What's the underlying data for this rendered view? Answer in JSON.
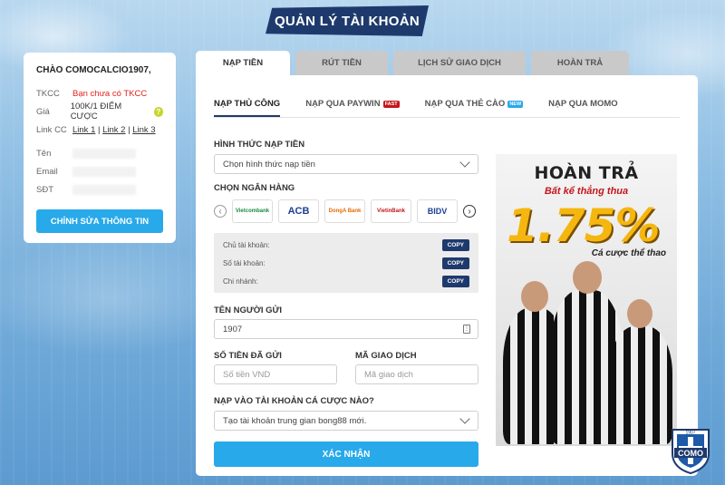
{
  "page_title": "QUẢN LÝ TÀI KHOẢN",
  "account": {
    "greeting": "CHÀO COMOCALCIO1907,",
    "rows": [
      {
        "label": "TKCC",
        "value": "Bạn chưa có TKCC"
      },
      {
        "label": "Giá",
        "value": "100K/1 ĐIỂM CƯỢC"
      },
      {
        "label": "Link CC",
        "links": [
          "Link 1",
          "Link 2",
          "Link 3"
        ]
      }
    ],
    "personal": [
      {
        "label": "Tên"
      },
      {
        "label": "Email"
      },
      {
        "label": "SĐT"
      }
    ],
    "edit_button": "CHỈNH SỬA THÔNG TIN",
    "help_symbol": "?"
  },
  "top_tabs": [
    "NẠP TIỀN",
    "RÚT TIỀN",
    "LỊCH SỬ GIAO DỊCH",
    "HOÀN TRẢ"
  ],
  "sub_tabs": [
    {
      "label": "NẠP THỦ CÔNG"
    },
    {
      "label": "NẠP QUA PAYWIN",
      "badge": "FAST"
    },
    {
      "label": "NẠP QUA THẺ CÀO",
      "badge": "NEW"
    },
    {
      "label": "NẠP QUA MOMO"
    }
  ],
  "form": {
    "method_label": "HÌNH THỨC NẠP TIỀN",
    "method_value": "Chọn hình thức nạp tiền",
    "bank_label": "CHỌN NGÂN HÀNG",
    "banks": [
      "Vietcombank",
      "ACB",
      "DongA Bank",
      "VietinBank",
      "BIDV"
    ],
    "account_fields": [
      "Chủ tài khoản:",
      "Số tài khoản:",
      "Chi nhánh:"
    ],
    "copy_label": "COPY",
    "sender_label": "TÊN NGƯỜI GỬI",
    "sender_value": "1907",
    "amount_label": "SỐ TIỀN ĐÃ GỬI",
    "amount_placeholder": "Số tiền VND",
    "txn_label": "MÃ GIAO DỊCH",
    "txn_placeholder": "Mã giao dịch",
    "target_label": "NẠP VÀO TÀI KHOẢN CÁ CƯỢC NÀO?",
    "target_value": "Tạo tài khoản trung gian bong88 mới.",
    "confirm_button": "XÁC NHẬN"
  },
  "ad": {
    "title": "HOÀN TRẢ",
    "subtitle": "Bất kể thắng thua",
    "percent": "1.75%",
    "description": "Cá cược thể thao"
  },
  "logo": {
    "year": "1907",
    "name": "COMO"
  },
  "colors": {
    "accent": "#28a9ea",
    "navy": "#1e3a6d",
    "red": "#e2231a"
  }
}
